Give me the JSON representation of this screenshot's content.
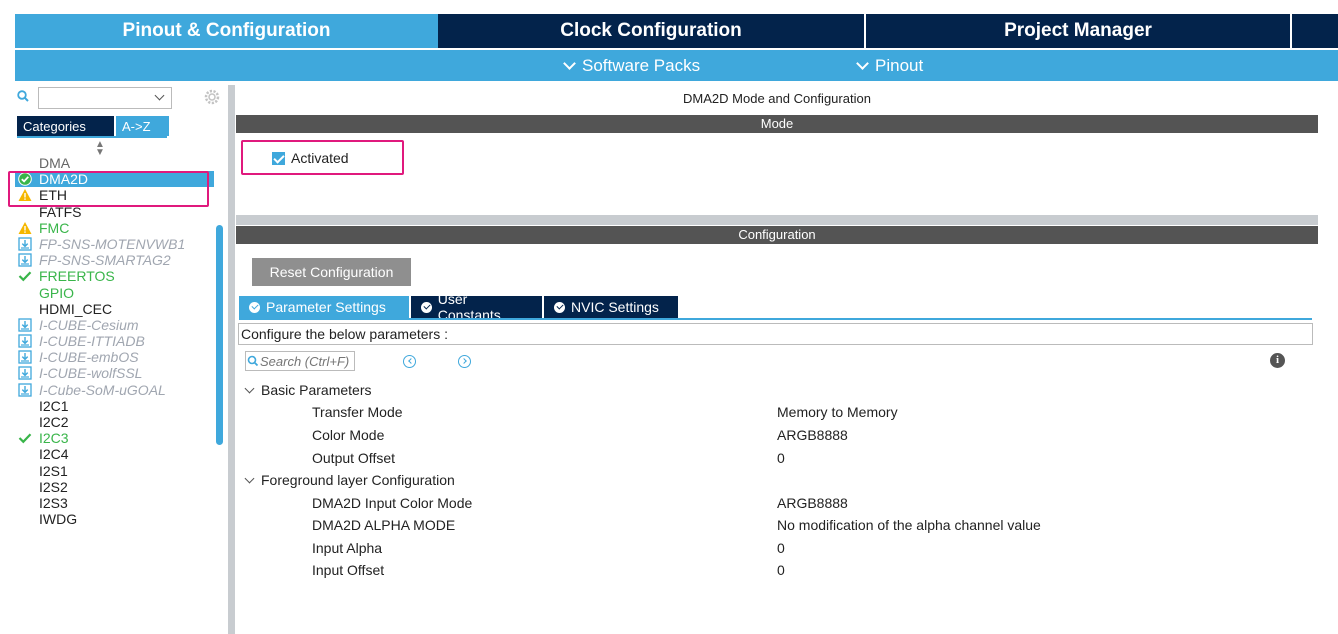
{
  "top_tabs": {
    "pinout": "Pinout & Configuration",
    "clock": "Clock Configuration",
    "project": "Project Manager"
  },
  "subbar": {
    "software_packs": "Software Packs",
    "pinout": "Pinout"
  },
  "left": {
    "tabs": {
      "categories": "Categories",
      "az": "A->Z"
    },
    "items": [
      {
        "label": "DMA",
        "state": "none"
      },
      {
        "label": "DMA2D",
        "state": "selected"
      },
      {
        "label": "ETH",
        "state": "warning"
      },
      {
        "label": "FATFS",
        "state": "none"
      },
      {
        "label": "FMC",
        "state": "warning"
      },
      {
        "label": "FP-SNS-MOTENVWB1",
        "state": "pack"
      },
      {
        "label": "FP-SNS-SMARTAG2",
        "state": "pack"
      },
      {
        "label": "FREERTOS",
        "state": "checked"
      },
      {
        "label": "GPIO",
        "state": "green"
      },
      {
        "label": "HDMI_CEC",
        "state": "none"
      },
      {
        "label": "I-CUBE-Cesium",
        "state": "pack"
      },
      {
        "label": "I-CUBE-ITTIADB",
        "state": "pack"
      },
      {
        "label": "I-CUBE-embOS",
        "state": "pack"
      },
      {
        "label": "I-CUBE-wolfSSL",
        "state": "pack"
      },
      {
        "label": "I-Cube-SoM-uGOAL",
        "state": "pack"
      },
      {
        "label": "I2C1",
        "state": "none"
      },
      {
        "label": "I2C2",
        "state": "none"
      },
      {
        "label": "I2C3",
        "state": "checked"
      },
      {
        "label": "I2C4",
        "state": "none"
      },
      {
        "label": "I2S1",
        "state": "none"
      },
      {
        "label": "I2S2",
        "state": "none"
      },
      {
        "label": "I2S3",
        "state": "none"
      },
      {
        "label": "IWDG",
        "state": "none"
      }
    ]
  },
  "main": {
    "title": "DMA2D Mode and Configuration",
    "mode_bar": "Mode",
    "activated_label": "Activated",
    "config_bar": "Configuration",
    "reset_button": "Reset Configuration",
    "tabs": {
      "parameter": "Parameter Settings",
      "user": "User Constants",
      "nvic": "NVIC Settings"
    },
    "configure_label": "Configure the below parameters :",
    "search_placeholder": "Search (Ctrl+F)",
    "groups": {
      "basic": {
        "title": "Basic Parameters",
        "params": [
          {
            "name": "Transfer Mode",
            "value": "Memory to Memory"
          },
          {
            "name": "Color Mode",
            "value": "ARGB8888"
          },
          {
            "name": "Output Offset",
            "value": "0"
          }
        ]
      },
      "foreground": {
        "title": "Foreground layer Configuration",
        "params": [
          {
            "name": "DMA2D Input Color Mode",
            "value": "ARGB8888"
          },
          {
            "name": "DMA2D ALPHA MODE",
            "value": "No modification of the alpha channel value"
          },
          {
            "name": "Input Alpha",
            "value": "0"
          },
          {
            "name": "Input Offset",
            "value": "0"
          }
        ]
      }
    }
  },
  "colors": {
    "accent": "#3fa8dc",
    "dark_navy": "#03234b",
    "section_bar": "#545454",
    "highlight": "#e0197d",
    "green": "#39b54a"
  }
}
